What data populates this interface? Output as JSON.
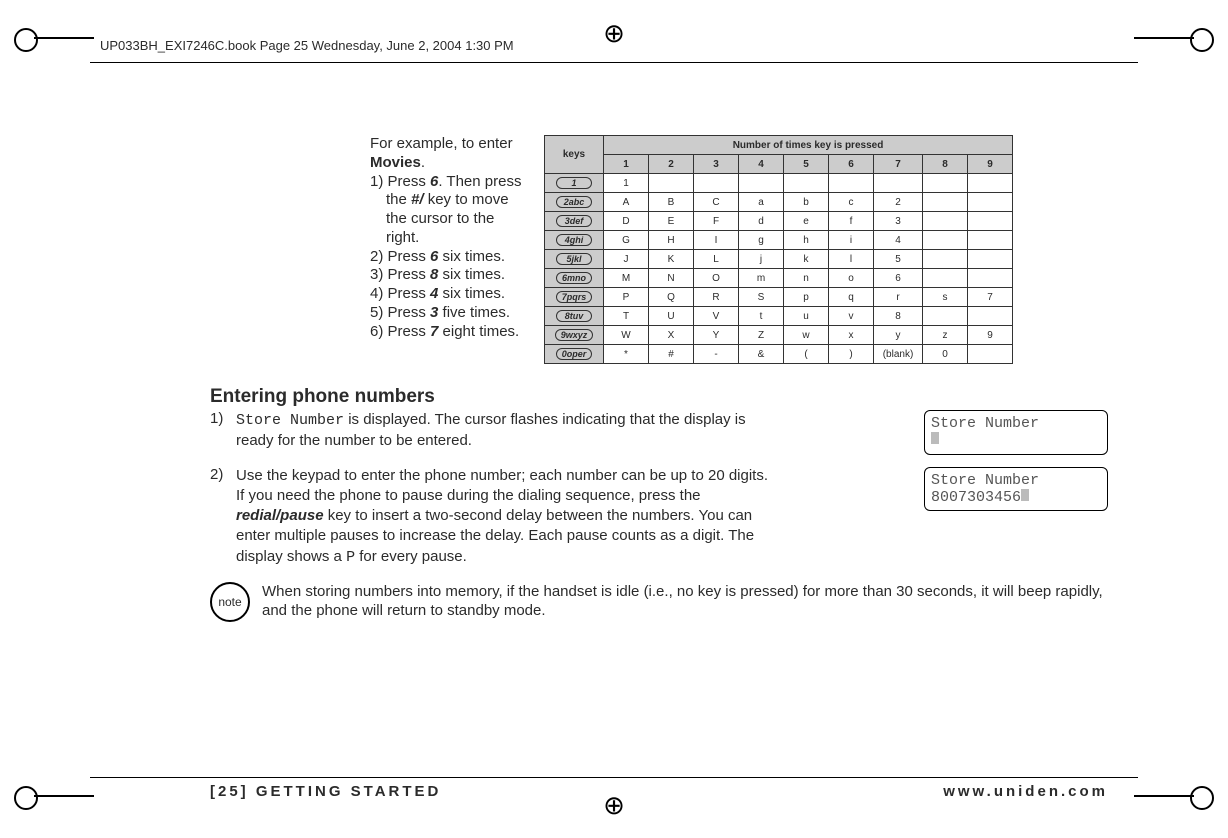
{
  "header": {
    "runhead": "UP033BH_EXI7246C.book  Page 25  Wednesday, June 2, 2004  1:30 PM"
  },
  "example": {
    "intro_a": "For example, to enter ",
    "intro_b": "Movies",
    "intro_c": ".",
    "steps": [
      {
        "pre": "1) Press ",
        "key": "6",
        "mid": ". Then press the ",
        "key2": "#/",
        "post": "    key to move the cursor to the right."
      },
      {
        "pre": "2) Press ",
        "key": "6",
        "post": " six times."
      },
      {
        "pre": "3) Press ",
        "key": "8",
        "post": " six times."
      },
      {
        "pre": "4) Press ",
        "key": "4",
        "post": " six times."
      },
      {
        "pre": "5) Press ",
        "key": "3",
        "post": " five times."
      },
      {
        "pre": "6) Press ",
        "key": "7",
        "post": " eight times."
      }
    ]
  },
  "keymap": {
    "title": "Number of times key is pressed",
    "keys_label": "keys",
    "cols": [
      "1",
      "2",
      "3",
      "4",
      "5",
      "6",
      "7",
      "8",
      "9"
    ],
    "rows": [
      {
        "cap": "1",
        "cells": [
          "1",
          "",
          "",
          "",
          "",
          "",
          "",
          "",
          ""
        ]
      },
      {
        "cap": "2abc",
        "cells": [
          "A",
          "B",
          "C",
          "a",
          "b",
          "c",
          "2",
          "",
          ""
        ]
      },
      {
        "cap": "3def",
        "cells": [
          "D",
          "E",
          "F",
          "d",
          "e",
          "f",
          "3",
          "",
          ""
        ]
      },
      {
        "cap": "4ghi",
        "cells": [
          "G",
          "H",
          "I",
          "g",
          "h",
          "i",
          "4",
          "",
          ""
        ]
      },
      {
        "cap": "5jkl",
        "cells": [
          "J",
          "K",
          "L",
          "j",
          "k",
          "l",
          "5",
          "",
          ""
        ]
      },
      {
        "cap": "6mno",
        "cells": [
          "M",
          "N",
          "O",
          "m",
          "n",
          "o",
          "6",
          "",
          ""
        ]
      },
      {
        "cap": "7pqrs",
        "cells": [
          "P",
          "Q",
          "R",
          "S",
          "p",
          "q",
          "r",
          "s",
          "7"
        ]
      },
      {
        "cap": "8tuv",
        "cells": [
          "T",
          "U",
          "V",
          "t",
          "u",
          "v",
          "8",
          "",
          ""
        ]
      },
      {
        "cap": "9wxyz",
        "cells": [
          "W",
          "X",
          "Y",
          "Z",
          "w",
          "x",
          "y",
          "z",
          "9"
        ]
      },
      {
        "cap": "0oper",
        "cells": [
          "*",
          "#",
          "-",
          "&",
          "(",
          ")",
          "(blank)",
          "0",
          ""
        ]
      }
    ]
  },
  "section": {
    "title": "Entering phone numbers",
    "step1_num": "1)",
    "step1_a": "",
    "step1_code": "Store Number",
    "step1_b": " is displayed. The cursor flashes indicating that the display is ready for the number to be entered.",
    "step2_num": "2)",
    "step2_a": "Use the keypad to enter the phone number; each number can be up to 20 digits.",
    "step2_b_pre": "If you need the phone to pause during the dialing sequence, press the ",
    "step2_b_key": "redial/pause",
    "step2_b_post": " key to insert a two-second delay between the numbers. You can enter multiple pauses to increase the delay. Each pause counts as a digit. The display shows a ",
    "step2_b_code": "P",
    "step2_b_tail": " for every pause."
  },
  "lcd": {
    "screen1_line1": "  Store Number",
    "screen2_line1": "  Store Number",
    "screen2_line2": "8007303456"
  },
  "note": {
    "badge": "note",
    "text": "When storing numbers into memory, if the handset is idle (i.e., no key is pressed) for more than 30 seconds, it will beep rapidly, and the phone will return to standby mode."
  },
  "footer": {
    "left": "[25] GETTING STARTED",
    "right": "www.uniden.com"
  }
}
